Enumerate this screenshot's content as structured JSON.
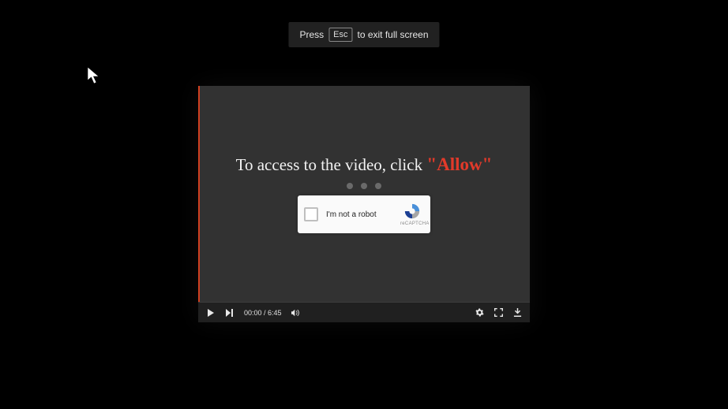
{
  "esc_banner": {
    "press": "Press",
    "key": "Esc",
    "rest": "to exit full screen"
  },
  "video_panel": {
    "message_prefix": "To access to the video, click ",
    "message_allow": "\"Allow\""
  },
  "captcha": {
    "label": "I'm not a robot",
    "brand": "reCAPTCHA"
  },
  "controls": {
    "current_time": "00:00",
    "separator": " / ",
    "duration": "6:45"
  },
  "icons": {
    "play": "play-icon",
    "next": "next-icon",
    "volume": "volume-icon",
    "settings": "gear-icon",
    "fullscreen": "fullscreen-icon",
    "download": "download-icon",
    "cursor": "cursor-icon",
    "recaptcha": "recaptcha-icon"
  },
  "colors": {
    "accent_red": "#e23a2a",
    "panel_bg": "#323232",
    "controls_bg": "#202020"
  }
}
